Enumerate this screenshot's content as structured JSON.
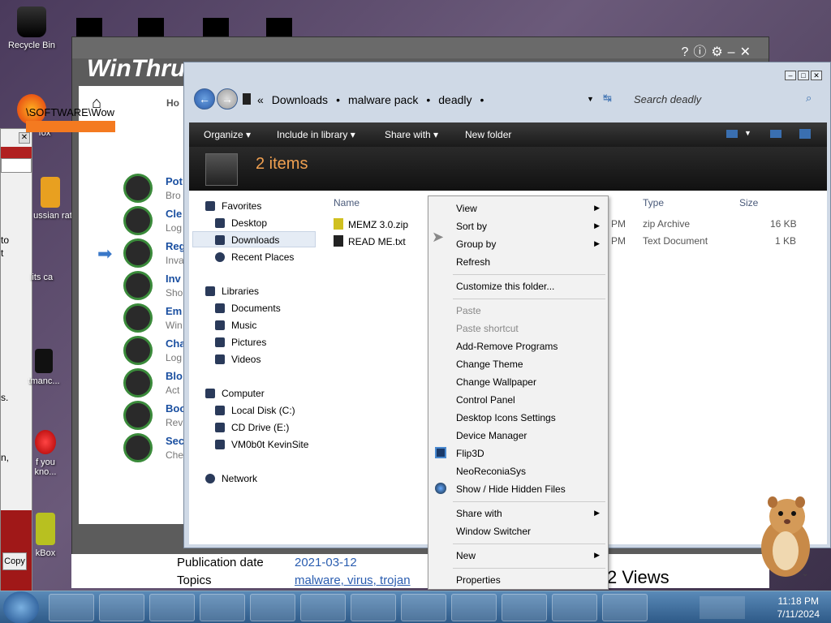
{
  "desktop": {
    "icons": [
      {
        "label": "Recycle Bin"
      },
      {
        "label": "fox"
      },
      {
        "label": "ussian rat"
      },
      {
        "label": "lits ca"
      },
      {
        "label": "tmanc..."
      },
      {
        "label": "f you kno..."
      },
      {
        "label": "kBox"
      }
    ]
  },
  "left_window": {
    "copy_label": "Copy",
    "frag_lines": [
      "to",
      "t",
      "s.",
      "n,"
    ]
  },
  "winthruster": {
    "logo": "WinThru",
    "home_label": "Ho",
    "reg_path": "\\SOFTWARE\\Wow",
    "items": [
      {
        "title": "Pot",
        "sub": "Bro"
      },
      {
        "title": "Cle",
        "sub": "Log"
      },
      {
        "title": "Reg",
        "sub": "Inva"
      },
      {
        "title": "Inv",
        "sub": "Sho"
      },
      {
        "title": "Em",
        "sub": "Win"
      },
      {
        "title": "Cha",
        "sub": "Log"
      },
      {
        "title": "Blo",
        "sub": "Act"
      },
      {
        "title": "Boo",
        "sub": "Rev"
      },
      {
        "title": "Sec",
        "sub": "Che"
      }
    ]
  },
  "page_strip": {
    "pub_label": "Publication date",
    "pub_value": "2021-03-12",
    "topics_label": "Topics",
    "topics_value": "malware, virus, trojan",
    "views": "2 Views"
  },
  "explorer": {
    "breadcrumb": [
      "Downloads",
      "malware pack",
      "deadly"
    ],
    "search_placeholder": "Search deadly",
    "commands": [
      "Organize",
      "Include in library",
      "Share with",
      "New folder"
    ],
    "item_count": "2 items",
    "nav": {
      "favorites": "Favorites",
      "desktop": "Desktop",
      "downloads": "Downloads",
      "recent": "Recent Places",
      "libraries": "Libraries",
      "documents": "Documents",
      "music": "Music",
      "pictures": "Pictures",
      "videos": "Videos",
      "computer": "Computer",
      "local_disk": "Local Disk (C:)",
      "cd_drive": "CD Drive (E:)",
      "vm": "VM0b0t KevinSite",
      "network": "Network"
    },
    "columns": {
      "name": "Name",
      "type": "Type",
      "size": "Size"
    },
    "files": [
      {
        "name": "MEMZ 3.0.zip",
        "time": "PM",
        "type": "zip Archive",
        "size": "16 KB"
      },
      {
        "name": "READ ME.txt",
        "time": "PM",
        "type": "Text Document",
        "size": "1 KB"
      }
    ]
  },
  "context_menu": {
    "view": "View",
    "sort_by": "Sort by",
    "group_by": "Group by",
    "refresh": "Refresh",
    "customize": "Customize this folder...",
    "paste": "Paste",
    "paste_shortcut": "Paste shortcut",
    "add_remove": "Add-Remove Programs",
    "change_theme": "Change Theme",
    "change_wallpaper": "Change Wallpaper",
    "control_panel": "Control Panel",
    "desktop_icons": "Desktop Icons Settings",
    "device_manager": "Device Manager",
    "flip3d": "Flip3D",
    "neoreconia": "NeoReconiaSys",
    "show_hide": "Show / Hide Hidden Files",
    "share_with": "Share with",
    "window_switcher": "Window Switcher",
    "new": "New",
    "properties": "Properties"
  },
  "taskbar": {
    "time": "11:18 PM",
    "date": "7/11/2024"
  }
}
